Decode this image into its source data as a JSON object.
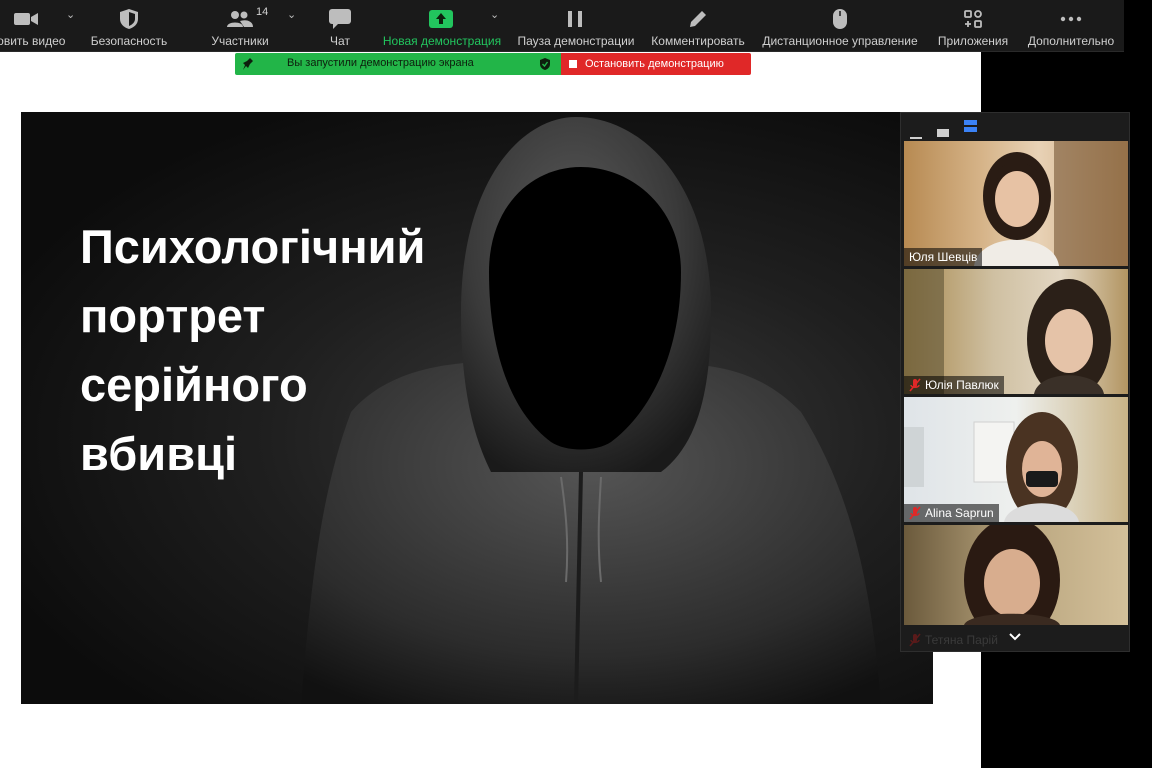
{
  "toolbar": {
    "items": [
      {
        "label": "новить видео",
        "icon": "video-camera-icon"
      },
      {
        "label": "Безопасность",
        "icon": "shield-icon"
      },
      {
        "label": "Участники",
        "icon": "participants-icon",
        "count": "14"
      },
      {
        "label": "Чат",
        "icon": "chat-bubble-icon"
      },
      {
        "label": "Новая демонстрация",
        "icon": "share-arrow-up-icon"
      },
      {
        "label": "Пауза демонстрации",
        "icon": "pause-icon"
      },
      {
        "label": "Комментировать",
        "icon": "pencil-icon"
      },
      {
        "label": "Дистанционное управление",
        "icon": "mouse-icon"
      },
      {
        "label": "Приложения",
        "icon": "apps-icon"
      },
      {
        "label": "Дополнительно",
        "icon": "more-dots-icon"
      }
    ]
  },
  "share_banner": {
    "status_text": "Вы запустили демонстрацию экрана",
    "stop_label": "Остановить демонстрацию"
  },
  "slide": {
    "title_lines": [
      "Психологічний",
      "портрет",
      "серійного",
      "вбивці"
    ]
  },
  "gallery": {
    "participants": [
      {
        "name": "Юля Шевців",
        "muted": false
      },
      {
        "name": "Юлія Павлюк",
        "muted": true
      },
      {
        "name": "Alina Saprun",
        "muted": true
      },
      {
        "name": "Тетяна Парій",
        "muted": true
      }
    ]
  },
  "colors": {
    "toolbar_bg": "#1a1a1a",
    "share_green": "#22b548",
    "stop_red": "#e02828",
    "accent_green": "#22c55e"
  }
}
